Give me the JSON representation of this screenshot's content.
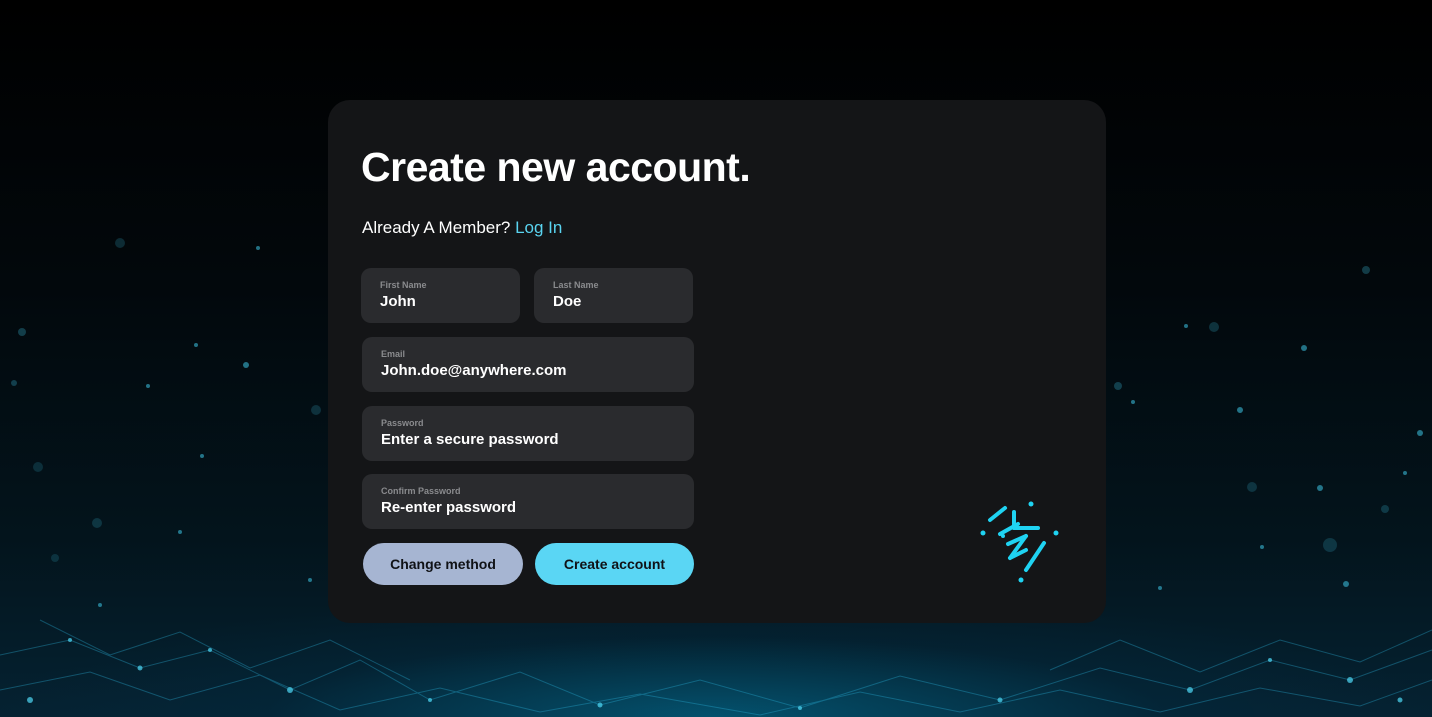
{
  "form": {
    "title": "Create new account.",
    "member_prompt": "Already A Member?",
    "login_link": "Log In",
    "fields": {
      "first_name": {
        "label": "First Name",
        "value": "John"
      },
      "last_name": {
        "label": "Last Name",
        "value": "Doe"
      },
      "email": {
        "label": "Email",
        "value": "John.doe@anywhere.com"
      },
      "password": {
        "label": "Password",
        "value": "Enter a secure password"
      },
      "confirm_password": {
        "label": "Confirm Password",
        "value": "Re-enter password"
      }
    },
    "buttons": {
      "change_method": "Change method",
      "create_account": "Create account"
    }
  },
  "colors": {
    "card_bg": "#141517",
    "field_bg": "#2a2b2e",
    "accent_cyan": "#5ad6f4",
    "secondary_button": "#a6b5d2",
    "link": "#5ad4f0"
  },
  "icons": {
    "brand_logo": "zigzag-logo-icon"
  }
}
